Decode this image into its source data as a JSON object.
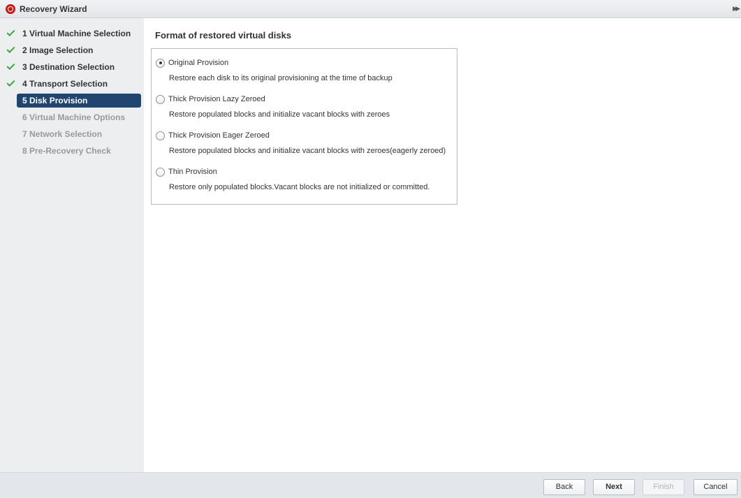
{
  "window": {
    "title": "Recovery Wizard"
  },
  "steps": [
    {
      "label": "1 Virtual Machine Selection",
      "state": "done"
    },
    {
      "label": "2 Image Selection",
      "state": "done"
    },
    {
      "label": "3 Destination Selection",
      "state": "done"
    },
    {
      "label": "4 Transport Selection",
      "state": "done"
    },
    {
      "label": "5 Disk Provision",
      "state": "current"
    },
    {
      "label": "6 Virtual Machine Options",
      "state": "pending"
    },
    {
      "label": "7 Network Selection",
      "state": "pending"
    },
    {
      "label": "8 Pre-Recovery Check",
      "state": "pending"
    }
  ],
  "main": {
    "title": "Format of restored virtual disks",
    "selected_option": "Original Provision",
    "options": [
      {
        "label": "Original Provision",
        "description": "Restore each disk to its original provisioning at the time of backup"
      },
      {
        "label": "Thick Provision Lazy Zeroed",
        "description": "Restore populated blocks and initialize vacant blocks with zeroes"
      },
      {
        "label": "Thick Provision Eager Zeroed",
        "description": "Restore populated blocks and initialize vacant blocks with zeroes(eagerly zeroed)"
      },
      {
        "label": "Thin Provision",
        "description": "Restore only populated blocks.Vacant blocks are not initialized or committed."
      }
    ]
  },
  "footer": {
    "back_label": "Back",
    "next_label": "Next",
    "finish_label": "Finish",
    "cancel_label": "Cancel",
    "finish_enabled": false
  },
  "colors": {
    "current_step_bg": "#20456e",
    "check_green": "#3aa34a",
    "app_icon_red": "#c61a1a"
  }
}
